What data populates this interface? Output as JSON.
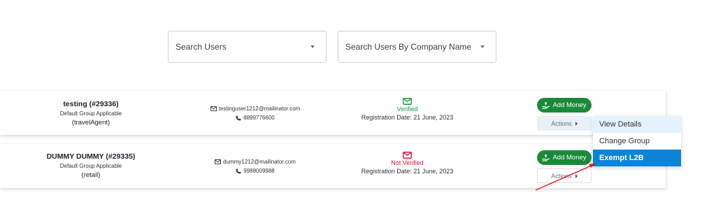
{
  "filters": {
    "search_users": "Search Users",
    "search_company": "Search Users By Company Name"
  },
  "users": [
    {
      "name": "testing (#29336)",
      "group": "Default Group Applicable",
      "role": "(travelAgent)",
      "email": "testinguser1212@mailinator.com",
      "phone": "8899776600",
      "status": "Verified",
      "registration": "Registration Date: 21 June, 2023"
    },
    {
      "name": "DUMMY DUMMY (#29335)",
      "group": "Default Group Applicable",
      "role": "(retail)",
      "email": "dummy1212@mailinator.com",
      "phone": "9988009988",
      "status": "Not Verified",
      "registration": "Registration Date: 21 June, 2023"
    }
  ],
  "buttons": {
    "add_money": "Add Money",
    "actions": "Actions"
  },
  "actions_menu": [
    "View Details",
    "Change Group",
    "Exempt L2B"
  ],
  "colors": {
    "verified": "#1a9a4a",
    "not_verified": "#e8143c",
    "add_money_bg": "#1a8a3a",
    "menu_highlight": "#0b84d8",
    "annotation_arrow": "#e8141c"
  },
  "icons": {
    "email": "envelope-icon",
    "phone": "phone-icon",
    "status": "envelope-icon",
    "add_money": "hand-money-icon",
    "actions": "caret-right-icon",
    "select": "caret-down-icon"
  }
}
